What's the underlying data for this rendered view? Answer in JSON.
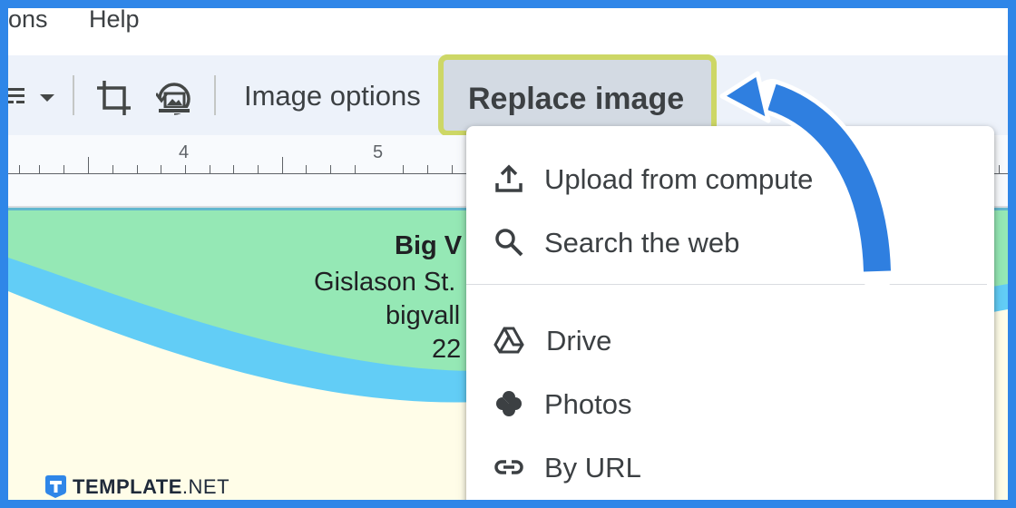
{
  "menubar": {
    "items": [
      "ons",
      "Help"
    ]
  },
  "toolbar": {
    "image_options_label": "Image options",
    "replace_image_label": "Replace image"
  },
  "ruler": {
    "labels": [
      "4",
      "5"
    ]
  },
  "document": {
    "line1": "Big V",
    "line2": "Gislason St.",
    "line3": "bigvall",
    "line4": "22"
  },
  "dropdown": {
    "items": [
      {
        "label": "Upload from compute",
        "icon": "upload-icon"
      },
      {
        "label": "Search the web",
        "icon": "search-icon"
      },
      {
        "label": "Drive",
        "icon": "drive-icon"
      },
      {
        "label": "Photos",
        "icon": "photos-icon"
      },
      {
        "label": "By URL",
        "icon": "link-icon"
      }
    ]
  },
  "brand": {
    "logo_text": "TEMPLATE",
    "logo_suffix": ".NET"
  },
  "colors": {
    "frame": "#2f86e8",
    "highlight_border": "#cdd766",
    "arrow": "#2f7fe0",
    "doc_header": "#95e8b5",
    "doc_wave": "#62cdf6",
    "doc_body": "#fffde8"
  }
}
